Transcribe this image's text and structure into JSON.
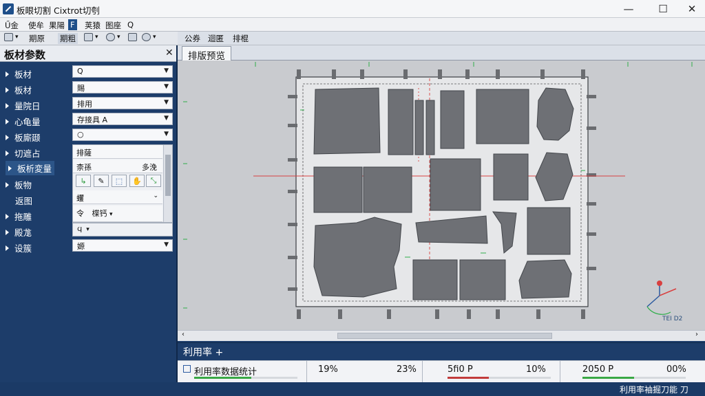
{
  "window": {
    "title": "板眼切割 Cixtrot切刳",
    "minimize": "—",
    "maximize": "☐",
    "close": "✕"
  },
  "menu": {
    "items": [
      {
        "label": "Ű金"
      },
      {
        "label": "使牟"
      },
      {
        "label": "果陽"
      },
      {
        "label": "F"
      },
      {
        "label": "荚猿"
      },
      {
        "label": "图座"
      },
      {
        "label": "Q"
      }
    ]
  },
  "toolbar": {
    "items": [
      "期原",
      "期粗",
      "",
      "",
      ""
    ],
    "right_items": [
      "公券",
      "迴匿",
      "排棍"
    ]
  },
  "left_panel": {
    "title": "板材参数",
    "close": "✕",
    "properties": [
      {
        "label": "板材",
        "value": "Q"
      },
      {
        "label": "板材",
        "value": "賜"
      },
      {
        "label": "量院日",
        "value": "排用"
      },
      {
        "label": "心龟量",
        "value": "存接具 A"
      },
      {
        "label": "板廝颋",
        "value": "○"
      },
      {
        "label": "切遮占",
        "value": "排薩"
      },
      {
        "label": "板析変量"
      },
      {
        "label": "板物"
      },
      {
        "label": "返图"
      },
      {
        "label": "拖雕"
      },
      {
        "label": "殿尨"
      },
      {
        "label": "设簇",
        "value": "嫄"
      }
    ],
    "subpanel": {
      "row1_left": "柰孫",
      "row1_right": "多浼",
      "row3": "蠼",
      "row4_left": "令",
      "row4_mid": "楪钙",
      "row5": "ϥ"
    }
  },
  "workspace": {
    "tab_label": "排版预览",
    "axis_label": "ΤΕΙ D2"
  },
  "utilization": {
    "title": "利用率 +",
    "cells": [
      {
        "label": "利用率数据统计",
        "value": "19%",
        "fill": 0.55,
        "color": "#39a845"
      },
      {
        "label": "",
        "value": "23%",
        "fill": 0.0,
        "color": "#39a845"
      },
      {
        "label": "5fi0 Р",
        "value": "10%",
        "fill": 0.4,
        "color": "#c23b3b"
      },
      {
        "label": "2050 Р",
        "value": "00%",
        "fill": 0.5,
        "color": "#39a845"
      }
    ]
  },
  "status": {
    "text": "利用率袖掘刀能   刀"
  },
  "colors": {
    "accent": "#1d3d6a",
    "part_fill": "#6e7075",
    "sheet": "#e7e8ea",
    "guide_red": "#d84040",
    "guide_green": "#2fae4a"
  }
}
